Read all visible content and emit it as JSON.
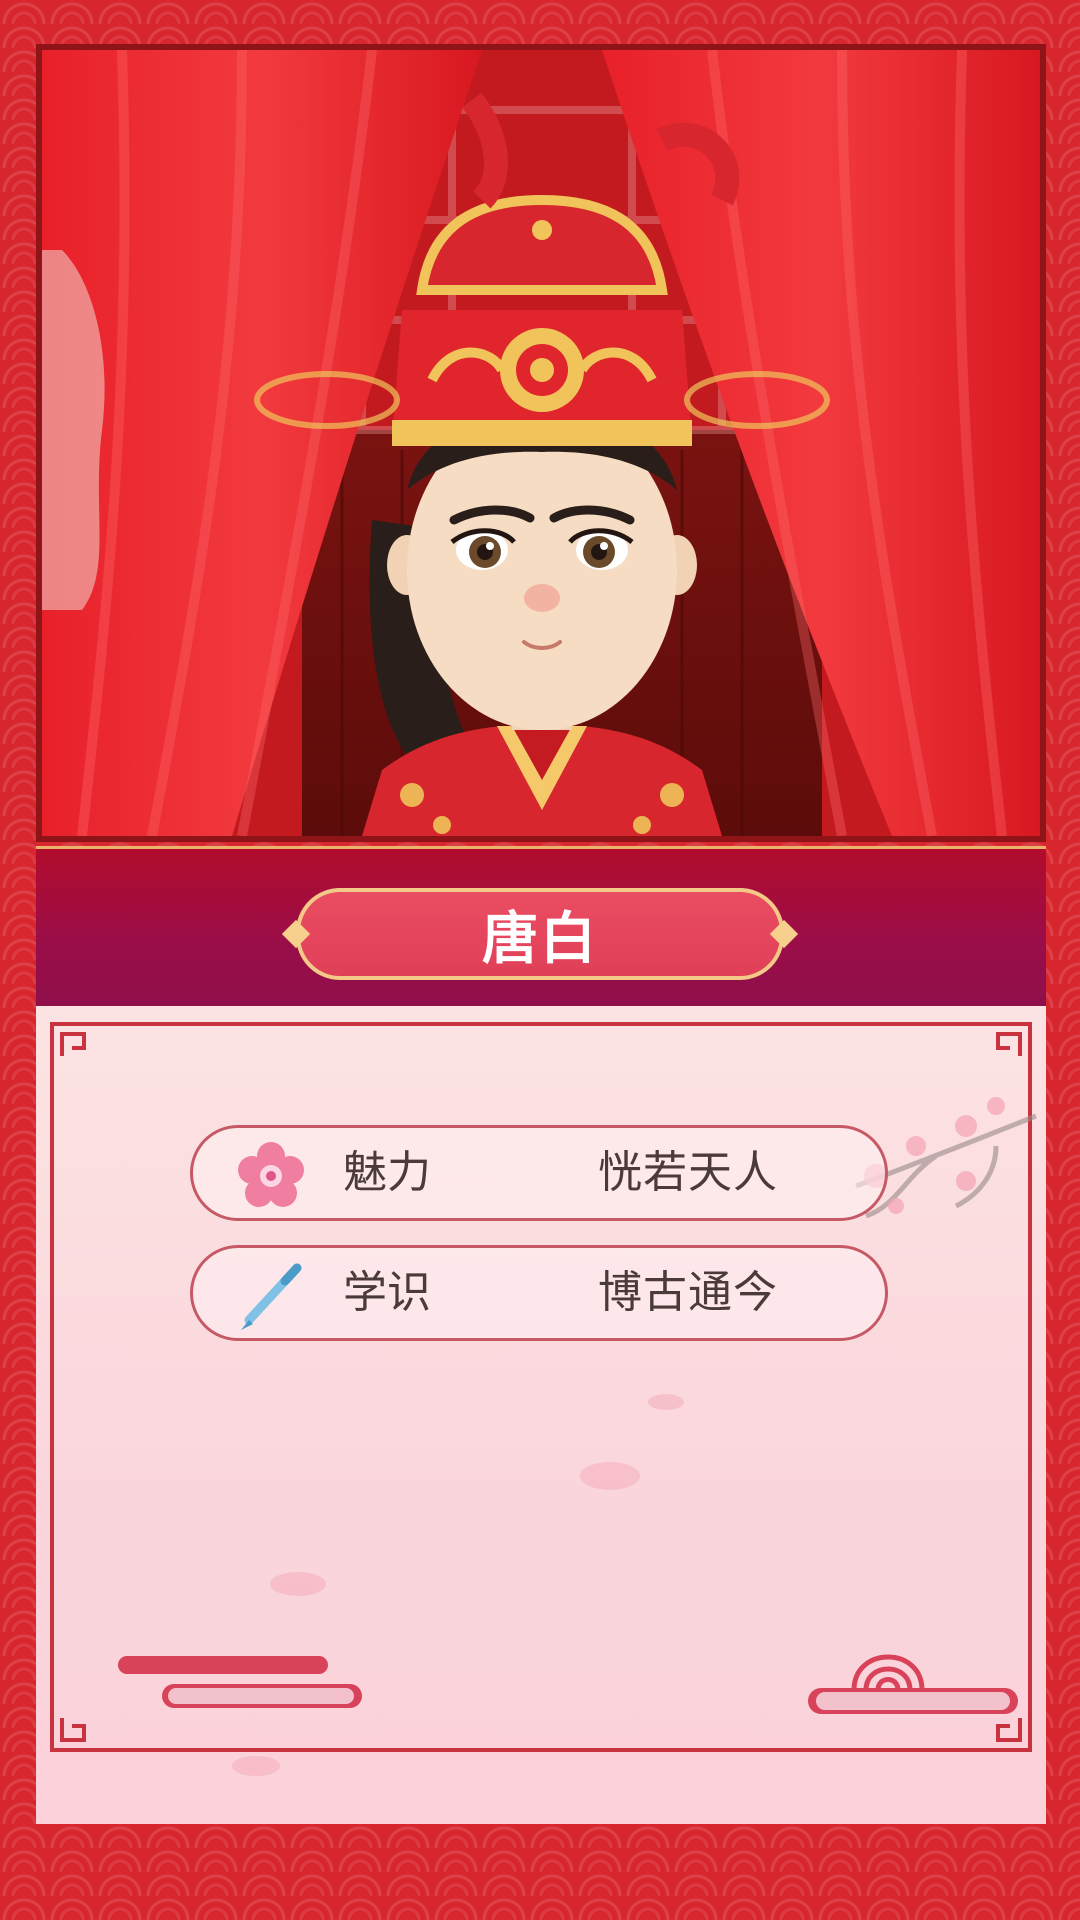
{
  "character": {
    "name": "唐白"
  },
  "stats": [
    {
      "icon": "plum-blossom-icon",
      "label": "魅力",
      "value": "恍若天人"
    },
    {
      "icon": "brush-icon",
      "label": "学识",
      "value": "博古通今"
    }
  ],
  "colors": {
    "background": "#d8262e",
    "banner": "#9a0e48",
    "name_plate": "#e03f58",
    "gold": "#f3c987",
    "card": "#fce3e3",
    "frame": "#c8333f"
  }
}
